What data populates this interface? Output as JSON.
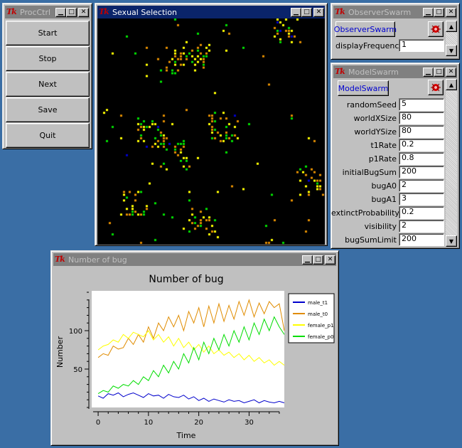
{
  "procctrl": {
    "title": "ProcCtrl",
    "buttons": [
      "Start",
      "Stop",
      "Next",
      "Save",
      "Quit"
    ]
  },
  "sexual": {
    "title": "Sexual Selection"
  },
  "observer": {
    "title": "ObserverSwarm",
    "button_label": "ObserverSwarm",
    "fields": [
      {
        "label": "displayFrequency",
        "value": "1"
      }
    ]
  },
  "model": {
    "title": "ModelSwarm",
    "button_label": "ModelSwarm",
    "fields": [
      {
        "label": "randomSeed",
        "value": "5"
      },
      {
        "label": "worldXSize",
        "value": "80"
      },
      {
        "label": "worldYSize",
        "value": "80"
      },
      {
        "label": "t1Rate",
        "value": "0.2"
      },
      {
        "label": "p1Rate",
        "value": "0.8"
      },
      {
        "label": "initialBugSum",
        "value": "200"
      },
      {
        "label": "bugA0",
        "value": "2"
      },
      {
        "label": "bugA1",
        "value": "3"
      },
      {
        "label": "extinctProbability",
        "value": "0.2"
      },
      {
        "label": "visibility",
        "value": "2"
      },
      {
        "label": "bugSumLimit",
        "value": "200"
      }
    ]
  },
  "graph_window": {
    "title": "Number of bug"
  },
  "colors": {
    "desktop": "#3a6ea5",
    "male_t1": "#0000cc",
    "male_t0": "#e08c00",
    "female_p1": "#ffff00",
    "female_p0": "#00dd00",
    "world_bg": "#000000"
  },
  "chart_data": {
    "type": "line",
    "title": "Number of bug",
    "xlabel": "Time",
    "ylabel": "Number",
    "xlim": [
      -1,
      37
    ],
    "ylim": [
      0,
      150
    ],
    "xticks": [
      0,
      10,
      20,
      30
    ],
    "yticks": [
      50,
      100
    ],
    "legend_position": "right",
    "x": [
      0,
      1,
      2,
      3,
      4,
      5,
      6,
      7,
      8,
      9,
      10,
      11,
      12,
      13,
      14,
      15,
      16,
      17,
      18,
      19,
      20,
      21,
      22,
      23,
      24,
      25,
      26,
      27,
      28,
      29,
      30,
      31,
      32,
      33,
      34,
      35,
      36,
      37
    ],
    "series": [
      {
        "name": "male_t1",
        "color": "#0000cc",
        "values": [
          15,
          12,
          18,
          16,
          19,
          14,
          17,
          19,
          16,
          13,
          18,
          15,
          16,
          12,
          17,
          14,
          13,
          16,
          11,
          14,
          9,
          12,
          8,
          11,
          9,
          7,
          10,
          8,
          9,
          6,
          8,
          10,
          6,
          9,
          7,
          6,
          8,
          6
        ]
      },
      {
        "name": "male_t0",
        "color": "#e08c00",
        "values": [
          65,
          70,
          68,
          80,
          76,
          78,
          90,
          82,
          95,
          85,
          105,
          90,
          110,
          100,
          118,
          105,
          120,
          100,
          125,
          110,
          130,
          105,
          132,
          110,
          135,
          112,
          133,
          115,
          138,
          120,
          140,
          118,
          136,
          122,
          138,
          130,
          135,
          100
        ]
      },
      {
        "name": "female_p1",
        "color": "#ffff00",
        "values": [
          75,
          80,
          82,
          88,
          85,
          95,
          90,
          98,
          95,
          92,
          100,
          88,
          95,
          85,
          92,
          80,
          90,
          78,
          85,
          75,
          82,
          72,
          80,
          70,
          75,
          68,
          72,
          65,
          70,
          62,
          68,
          60,
          65,
          58,
          62,
          55,
          60,
          55
        ]
      },
      {
        "name": "female_p0",
        "color": "#00dd00",
        "values": [
          18,
          22,
          20,
          28,
          25,
          30,
          28,
          35,
          30,
          40,
          35,
          48,
          40,
          55,
          45,
          60,
          50,
          70,
          58,
          78,
          62,
          85,
          70,
          90,
          75,
          95,
          80,
          100,
          85,
          105,
          88,
          110,
          95,
          115,
          100,
          118,
          105,
          95
        ]
      }
    ]
  }
}
